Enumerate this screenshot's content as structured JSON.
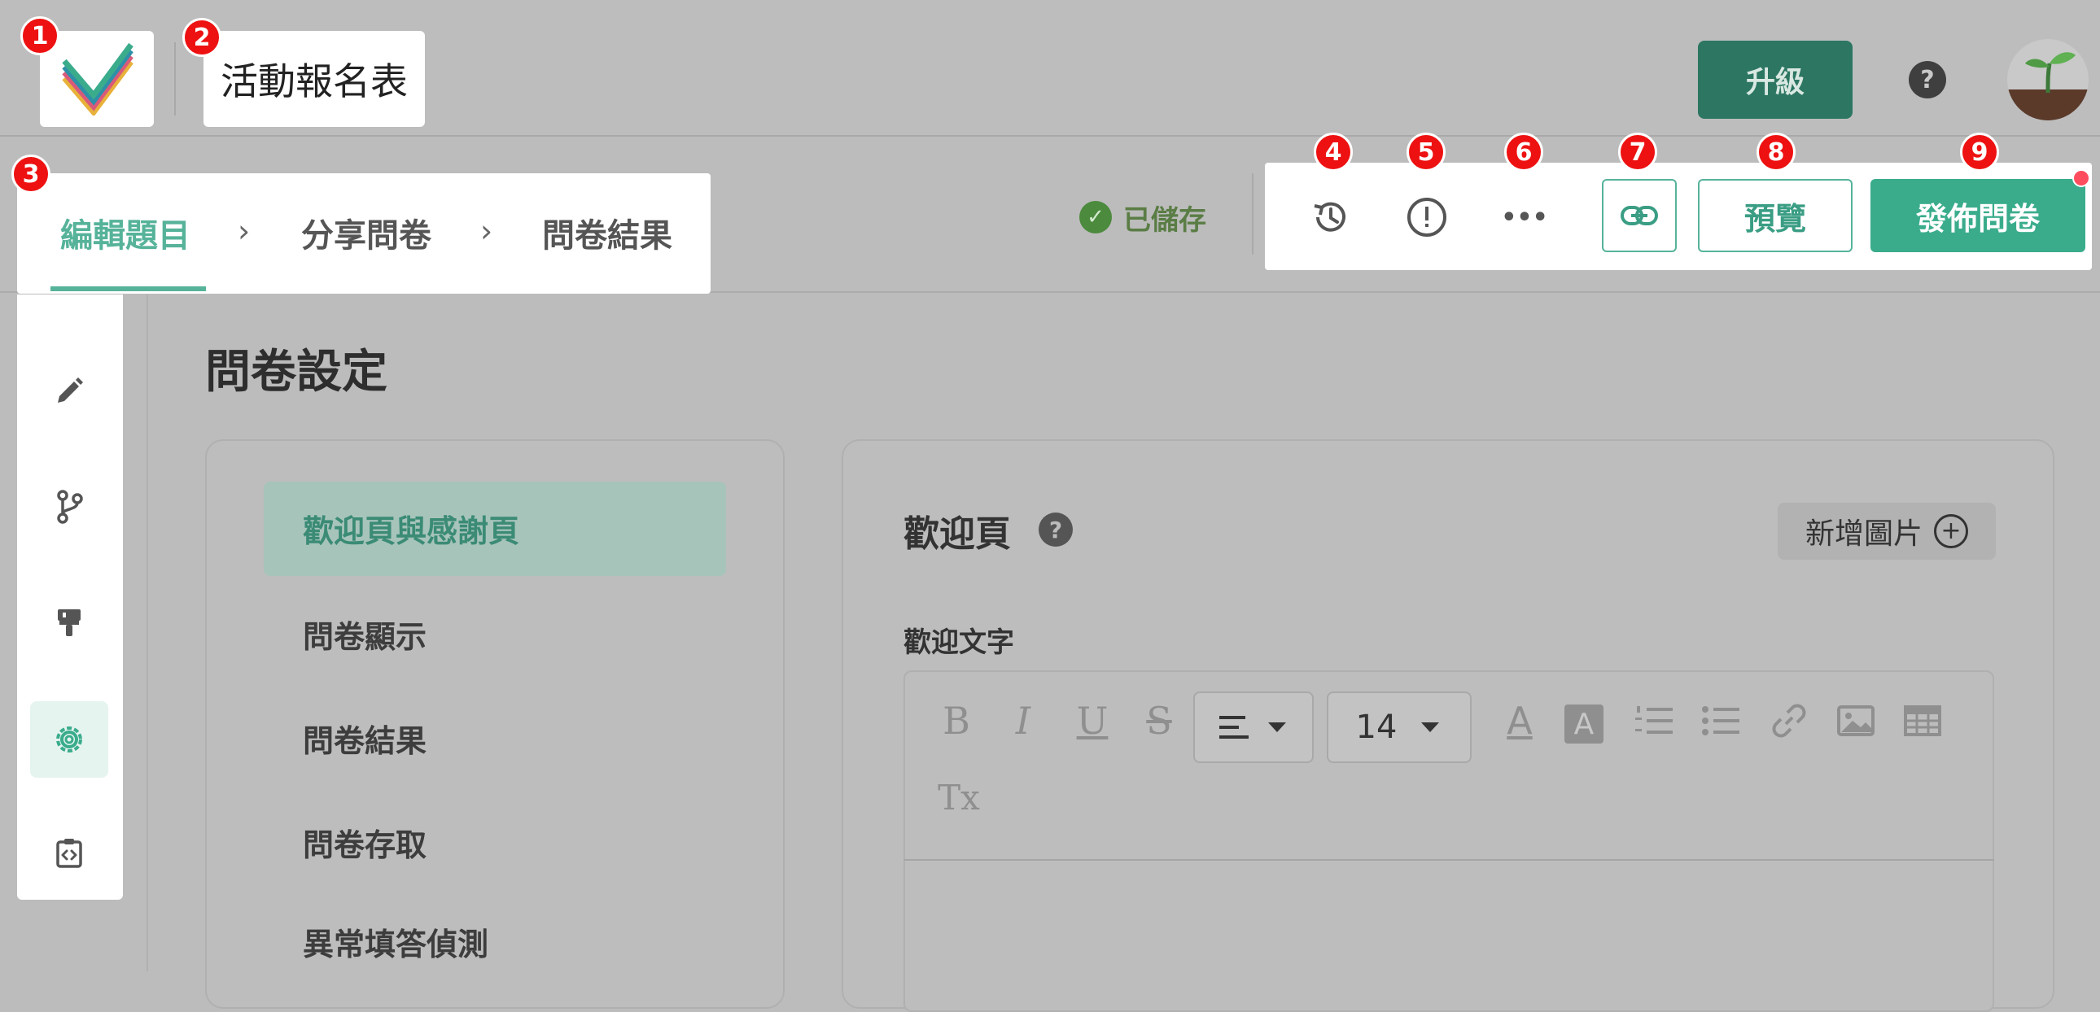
{
  "header": {
    "title": "活動報名表",
    "upgrade_label": "升級",
    "help_glyph": "?"
  },
  "steps": [
    {
      "label": "編輯題目",
      "active": true
    },
    {
      "label": "分享問卷",
      "active": false
    },
    {
      "label": "問卷結果",
      "active": false
    }
  ],
  "chevron": "›",
  "status": {
    "saved_label": "已儲存",
    "check_glyph": "✓"
  },
  "actions": {
    "more_glyph": "•••",
    "preview_label": "預覽",
    "publish_label": "發佈問卷"
  },
  "badges": [
    "1",
    "2",
    "3",
    "4",
    "5",
    "6",
    "7",
    "8",
    "9"
  ],
  "main": {
    "page_title": "問卷設定",
    "menu": [
      "歡迎頁與感謝頁",
      "問卷顯示",
      "問卷結果",
      "問卷存取",
      "異常填答偵測"
    ],
    "active_menu_index": 0,
    "welcome_title": "歡迎頁",
    "help_glyph": "?",
    "add_image_label": "新增圖片",
    "plus_glyph": "+",
    "welcome_text_label": "歡迎文字"
  },
  "toolbar": {
    "bold": "B",
    "italic": "I",
    "underline": "U",
    "strike": "S",
    "font_size": "14",
    "text_color_glyph": "A",
    "bg_color_glyph": "A",
    "clear_format": "Tx"
  },
  "colors": {
    "accent": "#56b39a",
    "publish": "#3aac8c",
    "upgrade": "#2c7662",
    "badge": "#ee1111",
    "saved": "#4c8a3d"
  }
}
